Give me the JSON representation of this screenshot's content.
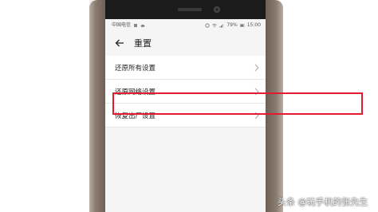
{
  "statusbar": {
    "carrier": "中国电信",
    "battery": "79%",
    "time": "15:00"
  },
  "header": {
    "title": "重置",
    "back_icon": "back-arrow-icon"
  },
  "settings": {
    "items": [
      {
        "label": "还原所有设置"
      },
      {
        "label": "还原网络设置"
      },
      {
        "label": "恢复出厂设置"
      }
    ]
  },
  "annotation": {
    "highlight_color": "#e21c2e"
  },
  "watermark": {
    "text": "头条 @玩手机的张先生"
  }
}
